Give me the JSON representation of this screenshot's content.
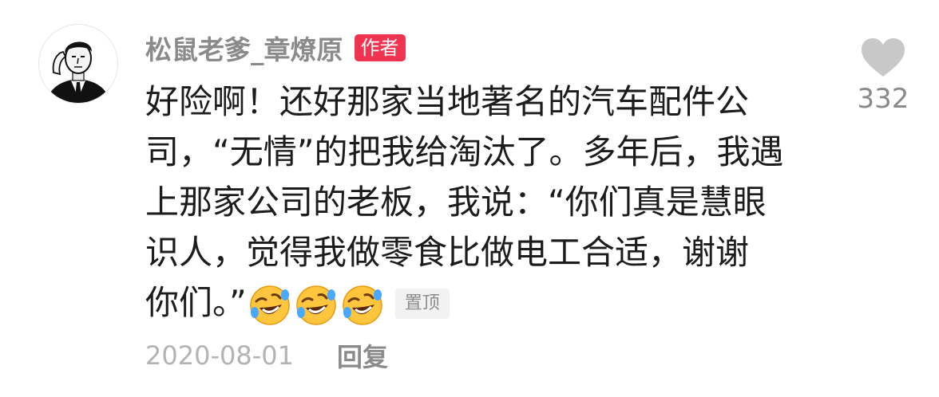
{
  "comment": {
    "author": "松鼠老爹_章燎原",
    "author_badge": "作者",
    "body_lines": [
      "好险啊！还好那家当地著名的汽车配件公",
      "司，“无情”的把我给淘汰了。多年后，我遇",
      "上那家公司的老板，我说：“你们真是慧眼",
      "识人，觉得我做零食比做电工合适，谢谢",
      "你们。”"
    ],
    "emojis": [
      "rofl-emoji",
      "rofl-emoji",
      "rofl-emoji"
    ],
    "pinned_label": "置顶",
    "date": "2020-08-01",
    "reply_label": "回复",
    "like_count": "332"
  },
  "icons": {
    "like": "heart-icon",
    "avatar": "avatar-portrait"
  },
  "colors": {
    "author_badge_bg": "#f0344f",
    "username": "#8a8a8a",
    "body_text": "#1c1c1c",
    "date": "#b3b3b3",
    "like_icon": "#c8c8c8",
    "pin_badge_bg": "#f2f2f2"
  }
}
